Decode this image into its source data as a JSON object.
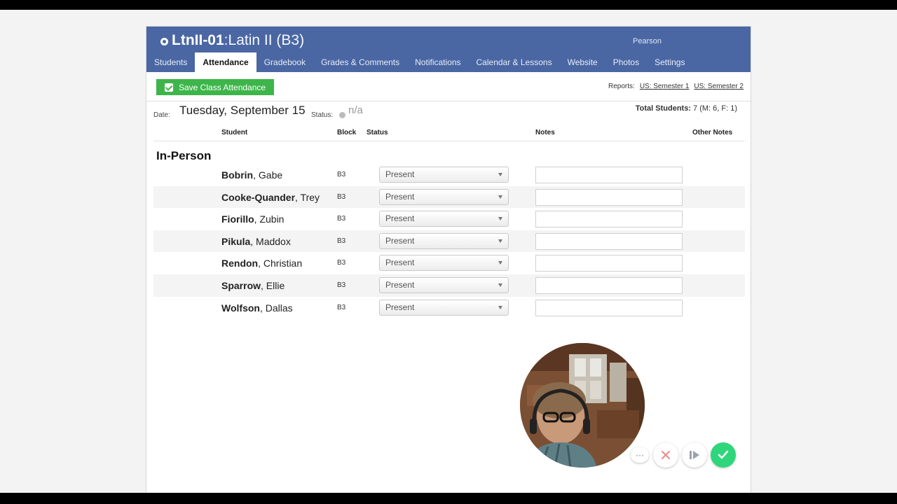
{
  "course": {
    "code": "LtnII-01",
    "separator": ":",
    "name": " Latin II (B3)",
    "teacher": "Pearson"
  },
  "tabs": [
    {
      "label": "Students",
      "active": false
    },
    {
      "label": "Attendance",
      "active": true
    },
    {
      "label": "Gradebook",
      "active": false
    },
    {
      "label": "Grades & Comments",
      "active": false
    },
    {
      "label": "Notifications",
      "active": false
    },
    {
      "label": "Calendar & Lessons",
      "active": false
    },
    {
      "label": "Website",
      "active": false
    },
    {
      "label": "Photos",
      "active": false
    },
    {
      "label": "Settings",
      "active": false
    }
  ],
  "toolbar": {
    "save_label": "Save Class Attendance",
    "reports_label": "Reports:",
    "report_links": [
      "US: Semester 1",
      "US: Semester 2"
    ]
  },
  "date_row": {
    "date_label": "Date:",
    "date_value": "Tuesday, September 15",
    "status_label": "Status:",
    "status_value": "n/a",
    "total_label": "Total Students:",
    "total_value": " 7 (M: 6, F: 1)"
  },
  "columns": {
    "student": "Student",
    "block": "Block",
    "status": "Status",
    "notes": "Notes",
    "other_notes": "Other Notes"
  },
  "section_title": "In-Person",
  "students": [
    {
      "last": "Bobrin",
      "first": ", Gabe",
      "block": "B3",
      "status": "Present"
    },
    {
      "last": "Cooke-Quander",
      "first": ", Trey",
      "block": "B3",
      "status": "Present"
    },
    {
      "last": "Fiorillo",
      "first": ", Zubin",
      "block": "B3",
      "status": "Present"
    },
    {
      "last": "Pikula",
      "first": ", Maddox",
      "block": "B3",
      "status": "Present"
    },
    {
      "last": "Rendon",
      "first": ", Christian",
      "block": "B3",
      "status": "Present"
    },
    {
      "last": "Sparrow",
      "first": ", Ellie",
      "block": "B3",
      "status": "Present"
    },
    {
      "last": "Wolfson",
      "first": ", Dallas",
      "block": "B3",
      "status": "Present"
    }
  ],
  "recorder": {
    "more_label": "···",
    "icons": [
      "more-icon",
      "close-icon",
      "next-icon",
      "check-icon"
    ]
  },
  "colors": {
    "header_blue": "#4a67a3",
    "save_green": "#3db54a",
    "confirm_green": "#2fd67c"
  }
}
